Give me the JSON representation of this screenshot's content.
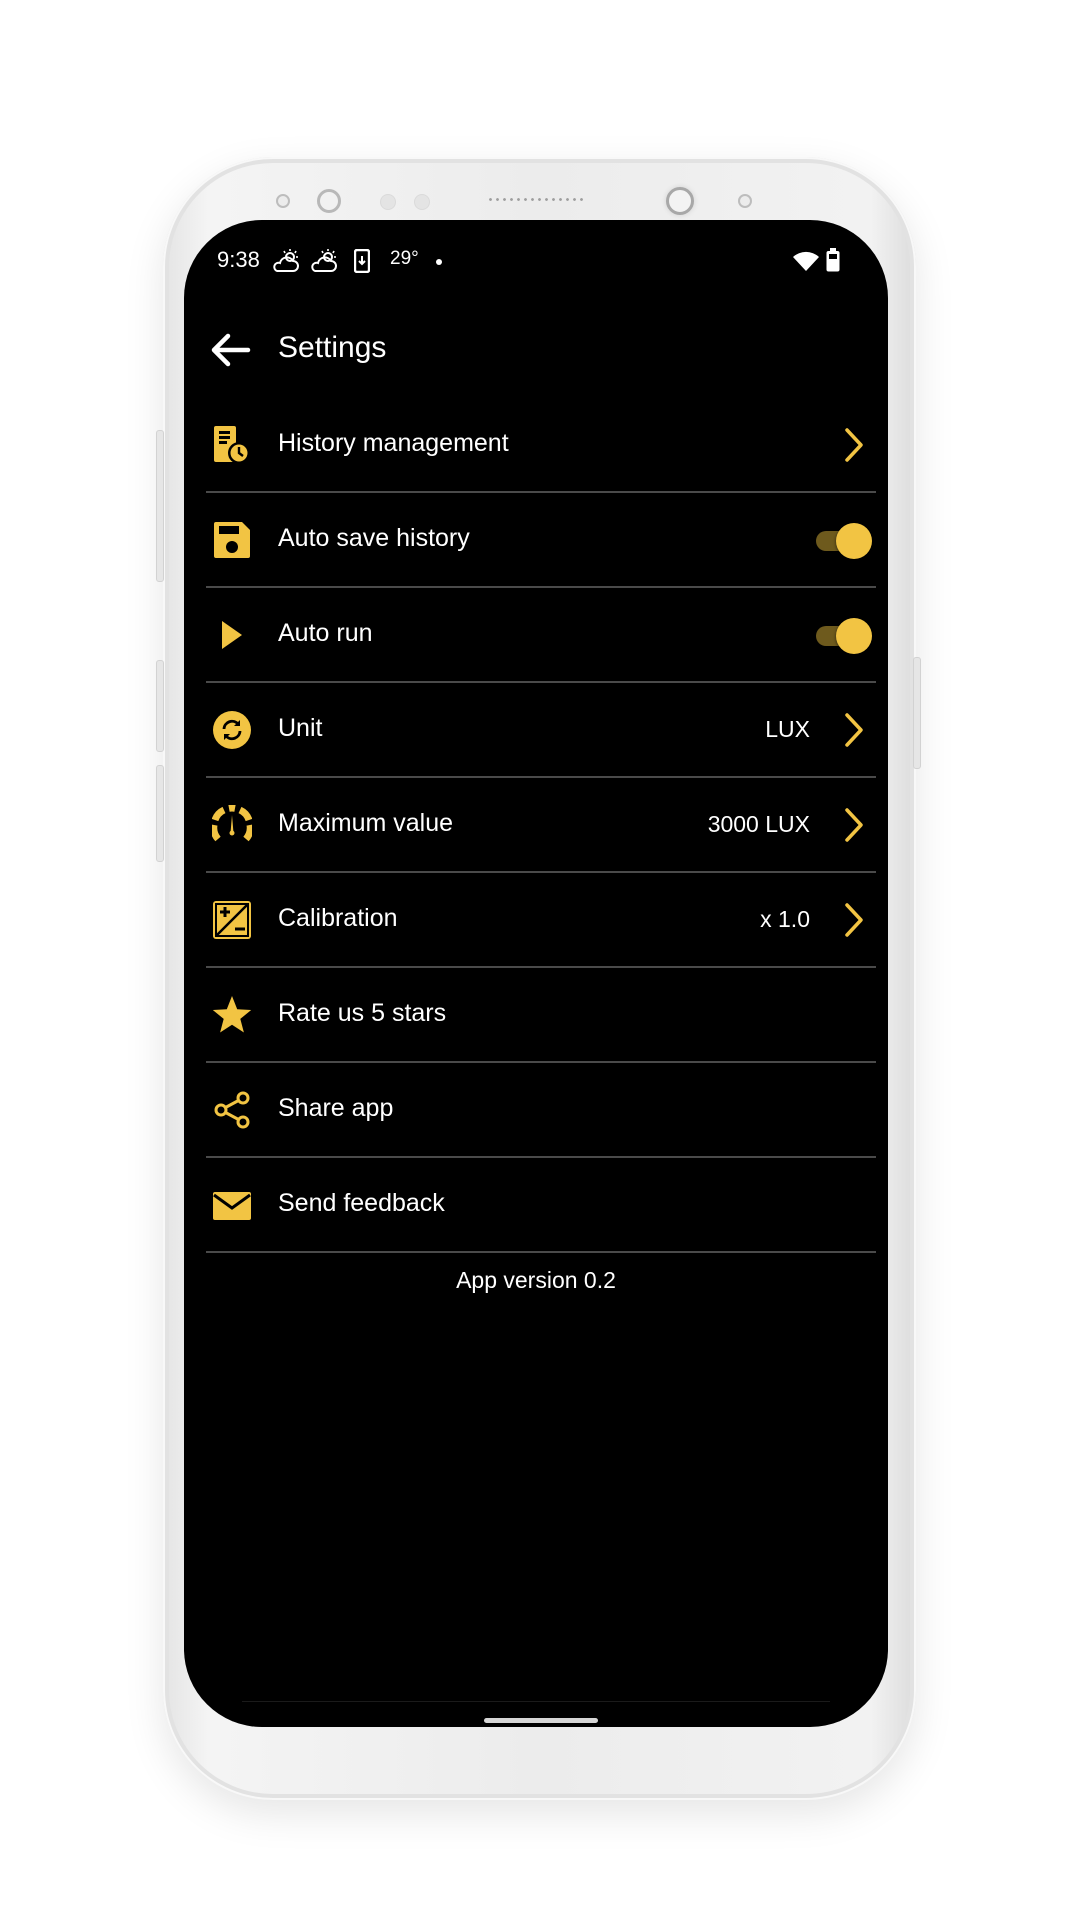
{
  "status_bar": {
    "time": "9:38",
    "temperature": "29°",
    "left_icons": [
      "weather-partly-cloudy-icon",
      "weather-partly-cloudy-icon",
      "download-phone-icon"
    ],
    "right_icons": [
      "wifi-icon",
      "battery-icon"
    ]
  },
  "app_bar": {
    "title": "Settings",
    "back_icon": "arrow-left-icon"
  },
  "accent_color": "#F2C443",
  "settings": [
    {
      "id": "history-management",
      "label": "History management",
      "icon": "history-document-icon",
      "type": "link"
    },
    {
      "id": "auto-save-history",
      "label": "Auto save history",
      "icon": "floppy-disk-icon",
      "type": "toggle",
      "enabled": true
    },
    {
      "id": "auto-run",
      "label": "Auto run",
      "icon": "play-icon",
      "type": "toggle",
      "enabled": true
    },
    {
      "id": "unit",
      "label": "Unit",
      "icon": "sync-circle-icon",
      "type": "link",
      "value": "LUX"
    },
    {
      "id": "maximum-value",
      "label": "Maximum value",
      "icon": "gauge-icon",
      "type": "link",
      "value": "3000 LUX"
    },
    {
      "id": "calibration",
      "label": "Calibration",
      "icon": "plus-minus-icon",
      "type": "link",
      "value": "x 1.0"
    },
    {
      "id": "rate-us",
      "label": "Rate us 5 stars",
      "icon": "star-icon",
      "type": "action"
    },
    {
      "id": "share-app",
      "label": "Share app",
      "icon": "share-icon",
      "type": "action"
    },
    {
      "id": "send-feedback",
      "label": "Send feedback",
      "icon": "envelope-icon",
      "type": "action"
    }
  ],
  "footer": {
    "version_text": "App version 0.2"
  }
}
